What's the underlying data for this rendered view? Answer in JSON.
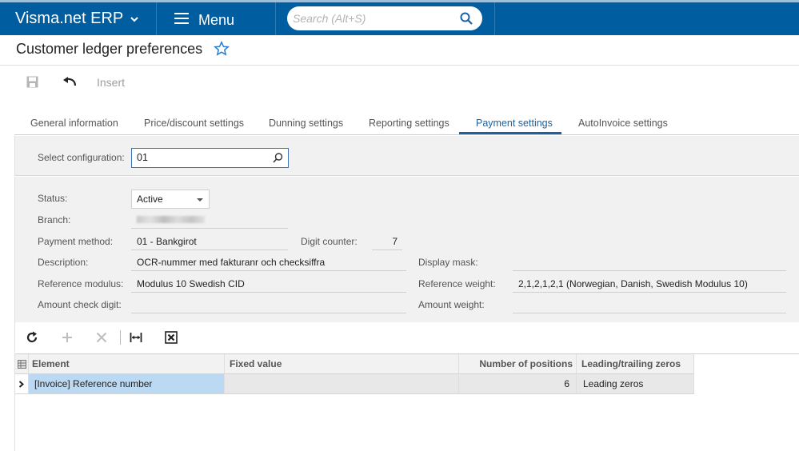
{
  "app": {
    "brand": "Visma.net ERP",
    "menu_label": "Menu",
    "search_placeholder": "Search (Alt+S)"
  },
  "page": {
    "title": "Customer ledger preferences"
  },
  "toolbar": {
    "insert_label": "Insert"
  },
  "tabs": [
    {
      "label": "General information"
    },
    {
      "label": "Price/discount settings"
    },
    {
      "label": "Dunning settings"
    },
    {
      "label": "Reporting settings"
    },
    {
      "label": "Payment settings",
      "active": true
    },
    {
      "label": "AutoInvoice settings"
    }
  ],
  "config": {
    "label": "Select configuration:",
    "value": "01"
  },
  "form": {
    "status_label": "Status:",
    "status_value": "Active",
    "branch_label": "Branch:",
    "payment_method_label": "Payment method:",
    "payment_method_value": "01 - Bankgirot",
    "digit_counter_label": "Digit counter:",
    "digit_counter_value": "7",
    "description_label": "Description:",
    "description_value": "OCR-nummer med fakturanr och checksiffra",
    "display_mask_label": "Display mask:",
    "display_mask_value": "",
    "reference_modulus_label": "Reference modulus:",
    "reference_modulus_value": "Modulus 10 Swedish CID",
    "reference_weight_label": "Reference weight:",
    "reference_weight_value": "2,1,2,1,2,1 (Norwegian, Danish, Swedish Modulus 10)",
    "amount_check_digit_label": "Amount check digit:",
    "amount_check_digit_value": "",
    "amount_weight_label": "Amount weight:",
    "amount_weight_value": ""
  },
  "grid": {
    "columns": [
      "Element",
      "Fixed value",
      "Number of positions",
      "Leading/trailing zeros"
    ],
    "rows": [
      {
        "element": "[Invoice] Reference number",
        "fixed_value": "",
        "number_of_positions": "6",
        "zeros": "Leading zeros"
      }
    ]
  },
  "colors": {
    "topbar": "#005ea0",
    "accent": "#1a62a6",
    "selected_row": "#bcd9f3"
  }
}
